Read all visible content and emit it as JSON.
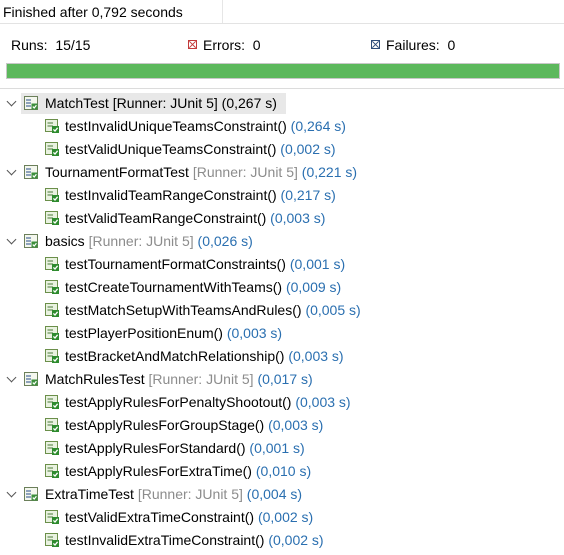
{
  "status": {
    "finished": "Finished after 0,792 seconds"
  },
  "counters": {
    "runs_label": "Runs:",
    "runs_value": "15/15",
    "errors_label": "Errors:",
    "errors_value": "0",
    "failures_label": "Failures:",
    "failures_value": "0"
  },
  "progress": {
    "fraction": 1.0,
    "color": "#5cb85c"
  },
  "suites": [
    {
      "name": "MatchTest",
      "runner": "[Runner: JUnit 5]",
      "time": "(0,267 s)",
      "selected": true,
      "tests": [
        {
          "name": "testInvalidUniqueTeamsConstraint()",
          "time": "(0,264 s)"
        },
        {
          "name": "testValidUniqueTeamsConstraint()",
          "time": "(0,002 s)"
        }
      ]
    },
    {
      "name": "TournamentFormatTest",
      "runner": "[Runner: JUnit 5]",
      "time": "(0,221 s)",
      "tests": [
        {
          "name": "testInvalidTeamRangeConstraint()",
          "time": "(0,217 s)"
        },
        {
          "name": "testValidTeamRangeConstraint()",
          "time": "(0,003 s)"
        }
      ]
    },
    {
      "name": "basics",
      "runner": "[Runner: JUnit 5]",
      "time": "(0,026 s)",
      "tests": [
        {
          "name": "testTournamentFormatConstraints()",
          "time": "(0,001 s)"
        },
        {
          "name": "testCreateTournamentWithTeams()",
          "time": "(0,009 s)"
        },
        {
          "name": "testMatchSetupWithTeamsAndRules()",
          "time": "(0,005 s)"
        },
        {
          "name": "testPlayerPositionEnum()",
          "time": "(0,003 s)"
        },
        {
          "name": "testBracketAndMatchRelationship()",
          "time": "(0,003 s)"
        }
      ]
    },
    {
      "name": "MatchRulesTest",
      "runner": "[Runner: JUnit 5]",
      "time": "(0,017 s)",
      "tests": [
        {
          "name": "testApplyRulesForPenaltyShootout()",
          "time": "(0,003 s)"
        },
        {
          "name": "testApplyRulesForGroupStage()",
          "time": "(0,003 s)"
        },
        {
          "name": "testApplyRulesForStandard()",
          "time": "(0,001 s)"
        },
        {
          "name": "testApplyRulesForExtraTime()",
          "time": "(0,010 s)"
        }
      ]
    },
    {
      "name": "ExtraTimeTest",
      "runner": "[Runner: JUnit 5]",
      "time": "(0,004 s)",
      "tests": [
        {
          "name": "testValidExtraTimeConstraint()",
          "time": "(0,002 s)"
        },
        {
          "name": "testInvalidExtraTimeConstraint()",
          "time": "(0,002 s)"
        }
      ]
    }
  ],
  "icons": {
    "suite": "test-suite-passed-icon",
    "test": "test-passed-icon",
    "errors": "error-icon",
    "failures": "failure-icon"
  }
}
